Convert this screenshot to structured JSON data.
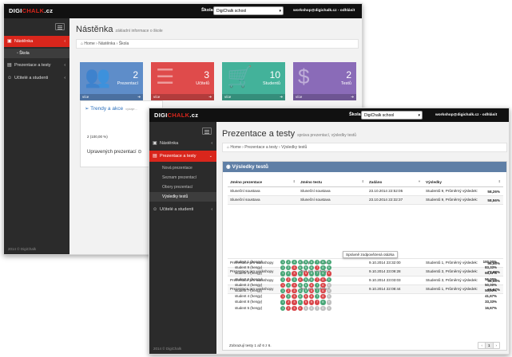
{
  "back": {
    "logo": {
      "part1": "DIGI",
      "part2": "CHALK",
      "part3": ".cz"
    },
    "school_label": "Škola:",
    "school_value": "DigiChalk school",
    "user": "workshop@digichalk.cz - odhlásit",
    "sidebar": [
      {
        "label": "Nástěnka",
        "icon": "dashboard-icon"
      },
      {
        "label": "Škola",
        "icon": "square-icon"
      },
      {
        "label": "Prezentace a testy",
        "icon": "folder-icon"
      },
      {
        "label": "Učitelé a studenti",
        "icon": "users-icon"
      }
    ],
    "footer": "2014 © DigiChalk",
    "title": "Nástěnka",
    "subtitle": "základní informace o škole",
    "breadcrumb": {
      "home": "Home",
      "b1": "Nástěnka",
      "b2": "Škola"
    },
    "tiles": [
      {
        "value": "2",
        "label": "Prezentací",
        "more": "více",
        "color": "#5e8dc9",
        "icon": "people-icon"
      },
      {
        "value": "3",
        "label": "Učitelů",
        "more": "více",
        "color": "#df4b4b",
        "icon": "list-icon"
      },
      {
        "value": "10",
        "label": "Studentů",
        "more": "více",
        "color": "#43b29a",
        "icon": "cart-icon"
      },
      {
        "value": "2",
        "label": "Testů",
        "more": "více",
        "color": "#8a6bb8",
        "icon": "dollar-icon"
      }
    ],
    "trends": {
      "title": "Trendy a akce",
      "subtitle": "výdaje...",
      "value": "2 (100,00 %)",
      "prezentaci": "Upravených prezentací"
    }
  },
  "front": {
    "logo": {
      "part1": "DIGI",
      "part2": "CHALK",
      "part3": ".cz"
    },
    "school_label": "Škola:",
    "school_value": "DigiChalk school",
    "user": "workshop@digichalk.cz - odhlásit",
    "sidebar": {
      "nastenka": "Nástěnka",
      "prezentace": "Prezentace a testy",
      "sub": [
        "Nová prezentace",
        "Seznam prezentací",
        "Obory prezentací",
        "Výsledky testů"
      ],
      "ucitele": "Učitelé a studenti"
    },
    "footer": "2014 © DigiChalk",
    "title": "Prezentace a testy",
    "subtitle": "správa prezentací, výsledky testů",
    "breadcrumb": {
      "home": "Home",
      "b1": "Prezentace a testy",
      "b2": "Výsledky testů"
    },
    "panel_title": "Výsledky testů",
    "columns": [
      "Jméno prezentace",
      "Jméno testu",
      "Zadáno",
      "Výsledky"
    ],
    "rows_top": [
      {
        "p": "Sluneční soustava",
        "t": "Sluneční soustava",
        "d": "23.10.2014 22:52:05",
        "r": "Studentů 9, Průměrný výsledek:",
        "pct": "58,26%"
      },
      {
        "p": "Sluneční soustava",
        "t": "Sluneční soustava",
        "d": "23.10.2014 22:32:37",
        "r": "Studentů 9, Průměrný výsledek:",
        "pct": "58,56%"
      }
    ],
    "tooltip": "Správně zodpovězená otázka",
    "students": [
      {
        "name": "student 1 (hengy)",
        "dots": "ggggggggg",
        "pct": "100,00%"
      },
      {
        "name": "student 9 (hengy)",
        "dots": "ggrgggrgg",
        "pct": "83,33%"
      },
      {
        "name": "student 3 (hengy)",
        "dots": "ggrgrgggr",
        "pct": "66,67%"
      },
      {
        "name": "student 6 (hengy)",
        "dots": "grgrggrrg",
        "pct": "56,00%"
      },
      {
        "name": "student 2 (hengy)",
        "dots": "rgrggrgre",
        "pct": "50,00%"
      },
      {
        "name": "student 7 (hengy)",
        "dots": "grrggrgre",
        "pct": "50,00%"
      },
      {
        "name": "student 4 (hengy)",
        "dots": "rgrgrrgre",
        "pct": "41,67%"
      },
      {
        "name": "student 8 (hengy)",
        "dots": "grrgrrrge",
        "pct": "33,33%"
      },
      {
        "name": "student 5 (hengy)",
        "dots": "grrreeeee",
        "pct": "16,67%"
      }
    ],
    "rows_bottom": [
      {
        "p": "Prezentace pro workshopy",
        "t": "Test pro workshop",
        "d": "9.10.2014 23:32:00",
        "r": "Studentů 1, Průměrný výsledek:",
        "pct": "56,56%"
      },
      {
        "p": "Prezentace pro workshopy",
        "t": "Test pro workshop",
        "d": "9.10.2014 23:09:28",
        "r": "Studentů 3, Průměrný výsledek:",
        "pct": "77,78%"
      },
      {
        "p": "Prezentace pro workshopy",
        "t": "Test pro workshop",
        "d": "9.10.2014 23:03:03",
        "r": "Studentů 3, Průměrný výsledek:",
        "pct": "58,56%"
      },
      {
        "p": "Prezentace pro workshopy",
        "t": "Test pro workshop",
        "d": "9.10.2014 22:08:44",
        "r": "Studentů 1, Průměrný výsledek:",
        "pct": "66,67%"
      }
    ],
    "footer_info": "Zobrazují testy 1 až 6 z 6.",
    "pager": [
      "‹",
      "1",
      "›"
    ]
  }
}
